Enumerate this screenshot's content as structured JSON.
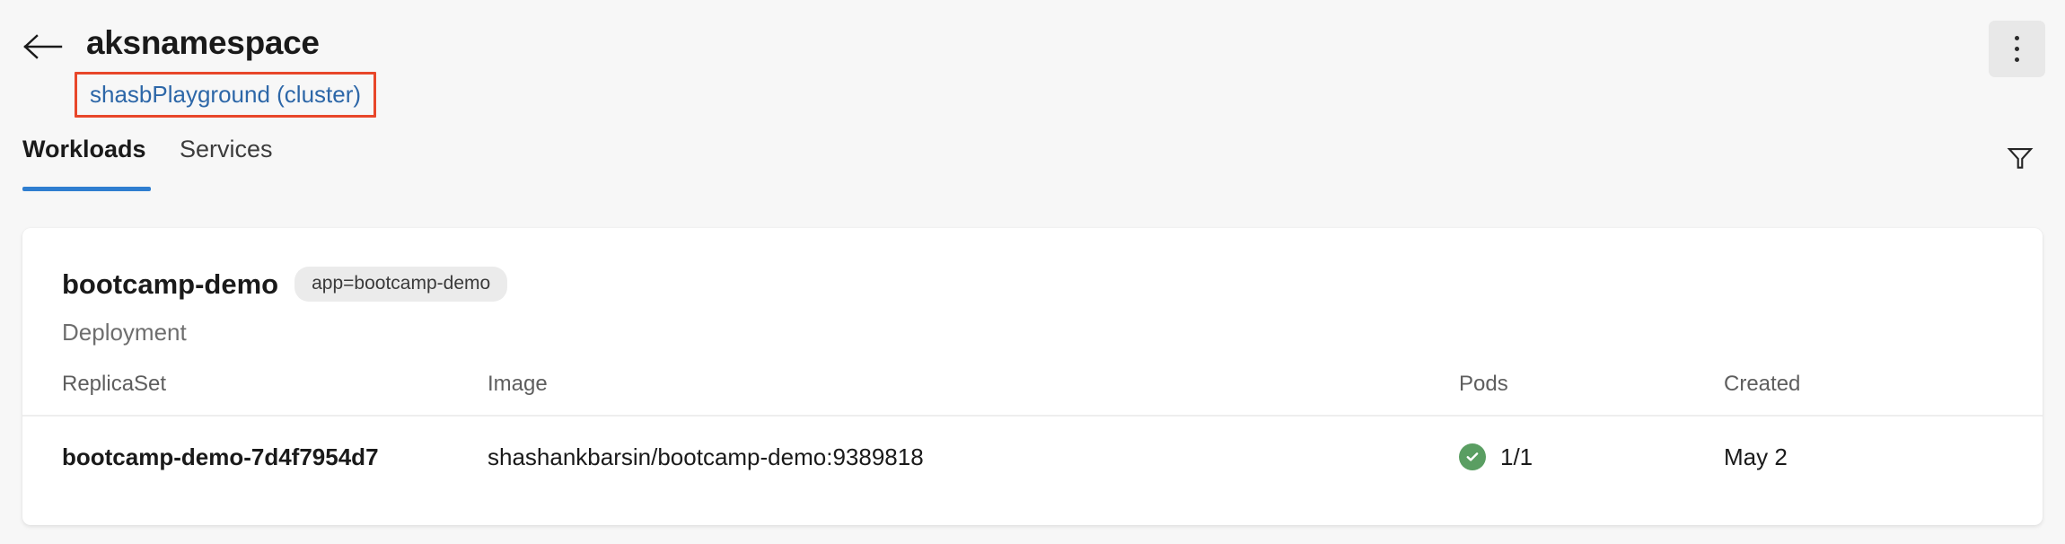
{
  "header": {
    "back_icon": "arrow-left-icon",
    "title": "aksnamespace",
    "cluster_link": "shasbPlayground (cluster)",
    "overflow_icon": "kebab-menu-icon",
    "annotation_color": "#e8472a",
    "link_color": "#2d67a8"
  },
  "tabs": {
    "items": [
      {
        "label": "Workloads",
        "active": true
      },
      {
        "label": "Services",
        "active": false
      }
    ],
    "active_underline_color": "#2f7ed0",
    "filter_icon": "filter-funnel-icon"
  },
  "card": {
    "resource_name": "bootcamp-demo",
    "label_badge": "app=bootcamp-demo",
    "resource_kind": "Deployment",
    "table": {
      "columns": [
        "ReplicaSet",
        "Image",
        "Pods",
        "Created"
      ],
      "rows": [
        {
          "replicaset": "bootcamp-demo-7d4f7954d7",
          "image": "shashankbarsin/bootcamp-demo:9389818",
          "pods": "1/1",
          "pods_status_icon": "check-circle-icon",
          "pods_status_color": "#5a9e62",
          "created": "May 2"
        }
      ]
    }
  }
}
